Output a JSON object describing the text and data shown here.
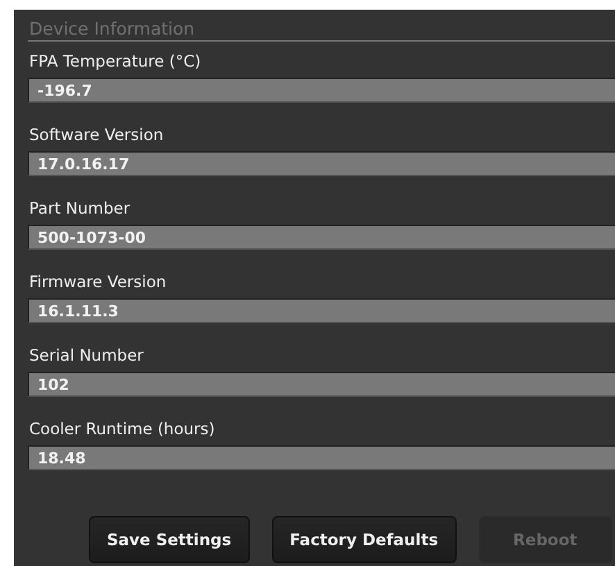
{
  "section": {
    "title": "Device Information"
  },
  "fields": [
    {
      "label": "FPA Temperature (°C)",
      "value": "-196.7"
    },
    {
      "label": "Software Version",
      "value": "17.0.16.17"
    },
    {
      "label": "Part Number",
      "value": "500-1073-00"
    },
    {
      "label": "Firmware Version",
      "value": "16.1.11.3"
    },
    {
      "label": "Serial Number",
      "value": "102"
    },
    {
      "label": "Cooler Runtime (hours)",
      "value": "18.48"
    }
  ],
  "buttons": [
    {
      "label": "Save Settings",
      "disabled": false
    },
    {
      "label": "Factory Defaults",
      "disabled": false
    },
    {
      "label": "Reboot",
      "disabled": true
    }
  ]
}
